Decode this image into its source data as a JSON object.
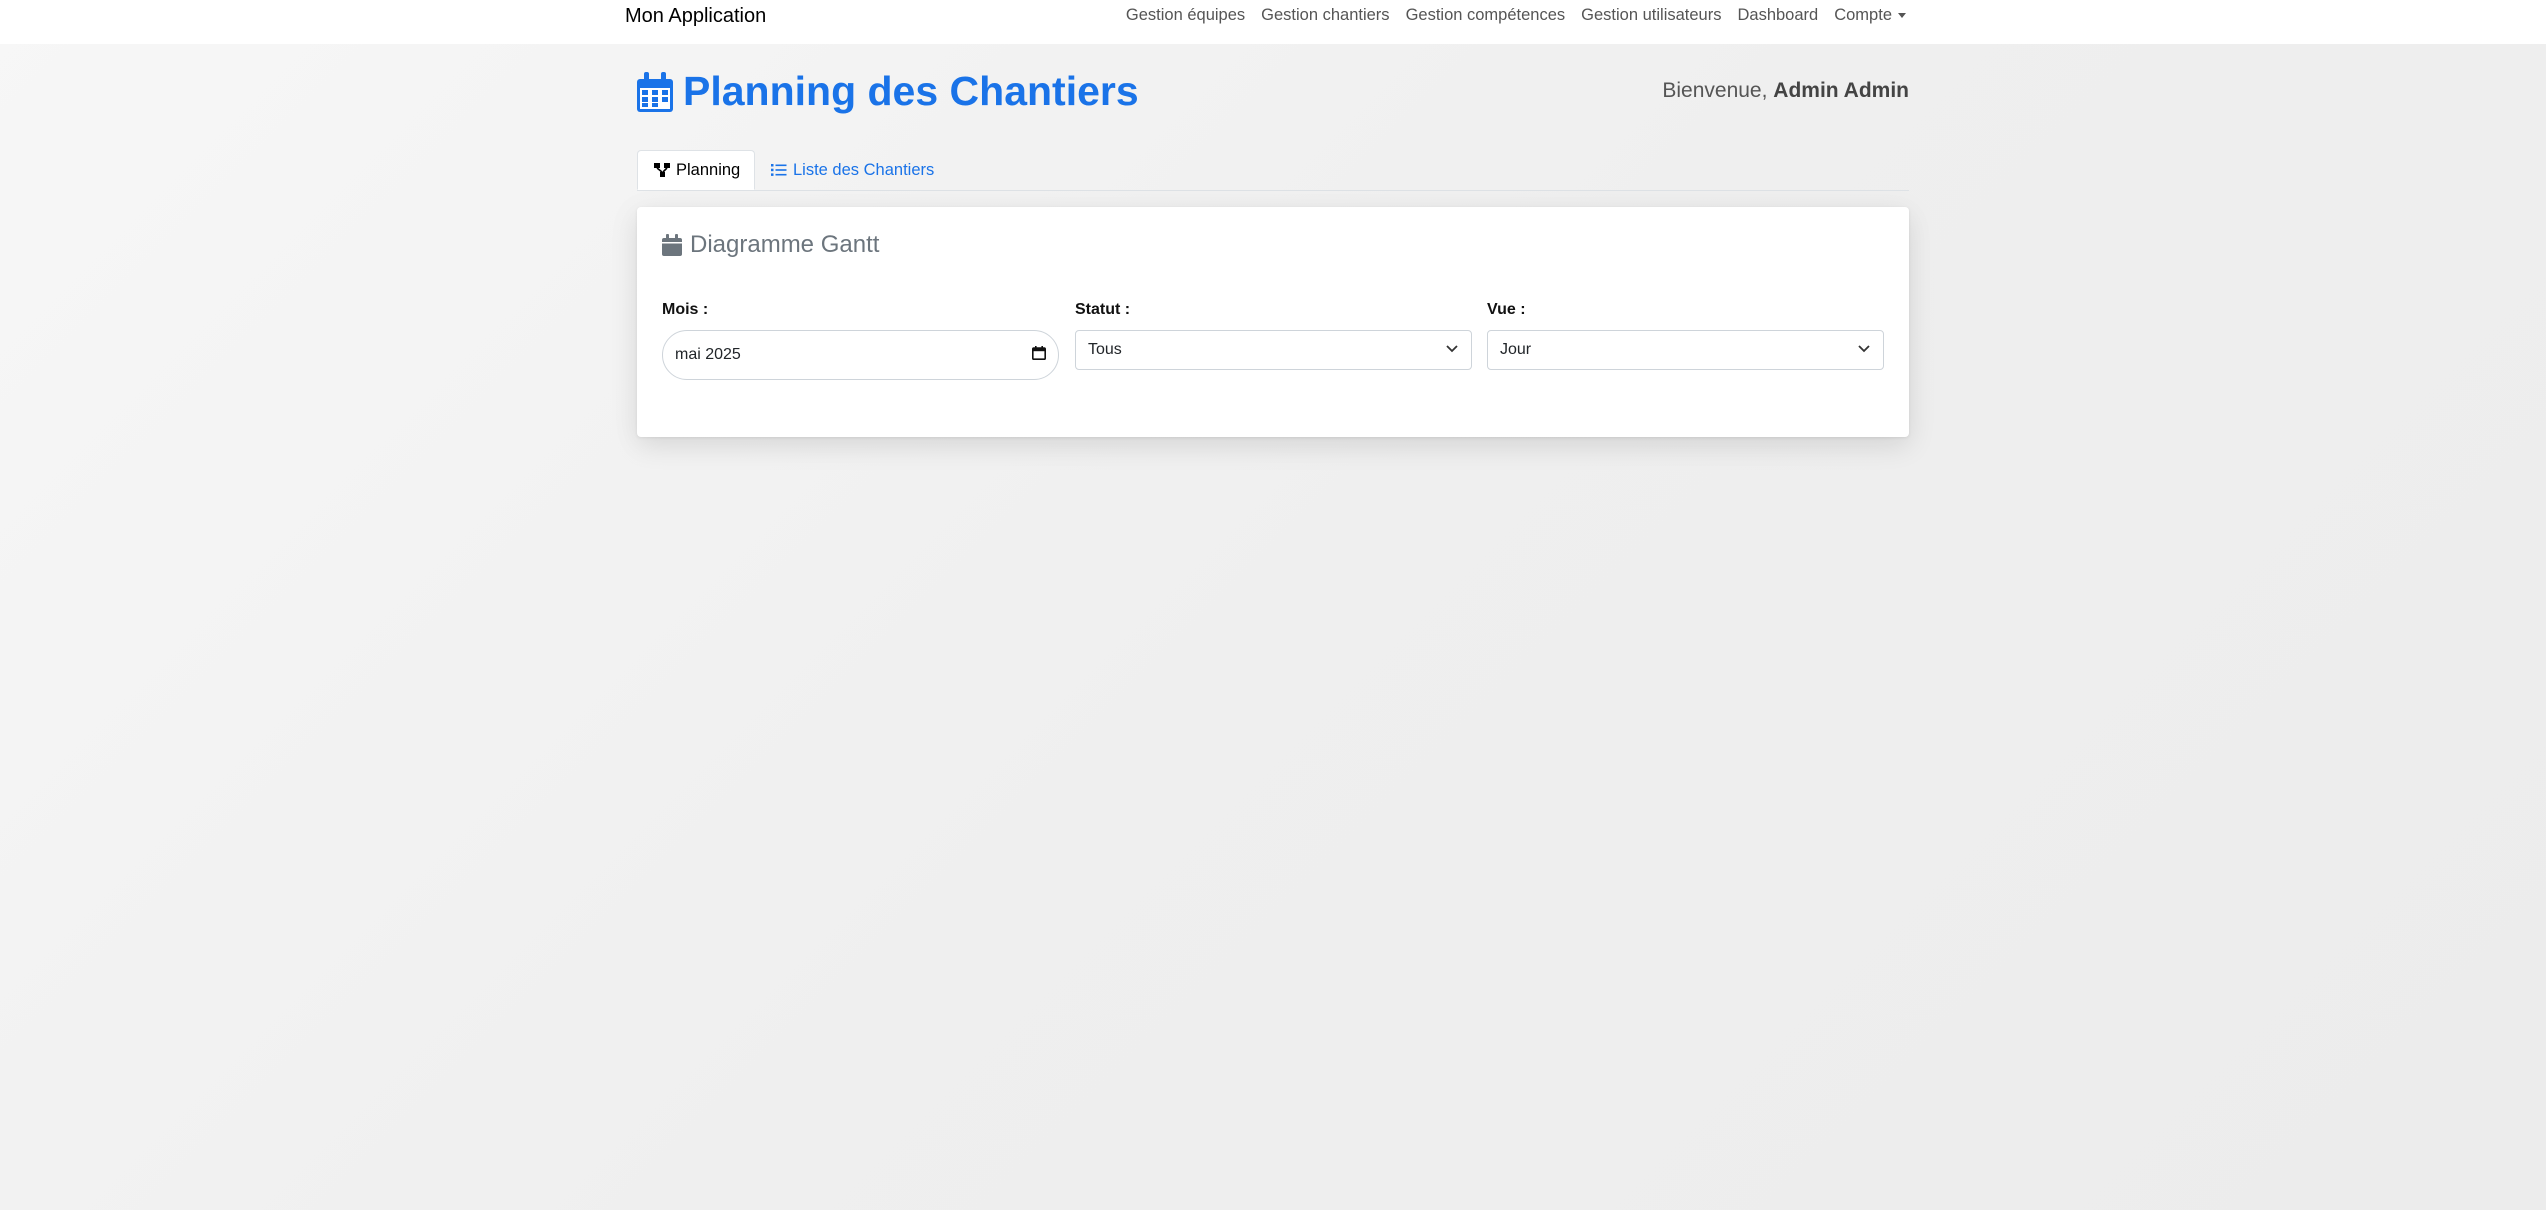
{
  "navbar": {
    "brand": "Mon Application",
    "links": [
      "Gestion équipes",
      "Gestion chantiers",
      "Gestion compétences",
      "Gestion utilisateurs",
      "Dashboard",
      "Compte"
    ]
  },
  "header": {
    "title": "Planning des Chantiers",
    "welcome_prefix": "Bienvenue, ",
    "user_name": "Admin Admin"
  },
  "tabs": [
    {
      "label": "Planning",
      "active": true
    },
    {
      "label": "Liste des Chantiers",
      "active": false
    }
  ],
  "card": {
    "title": "Diagramme Gantt",
    "filters": {
      "month": {
        "label": "Mois :",
        "value": "mai 2025"
      },
      "status": {
        "label": "Statut :",
        "value": "Tous"
      },
      "view": {
        "label": "Vue :",
        "value": "Jour"
      }
    }
  },
  "colors": {
    "accent": "#1a73e8",
    "muted": "#6c757d"
  },
  "icons": {
    "title": "calendar-icon",
    "tab_planning": "gantt-icon",
    "tab_list": "list-icon",
    "card": "calendar-icon",
    "month_picker": "calendar-small-icon",
    "select": "chevron-down-icon"
  }
}
